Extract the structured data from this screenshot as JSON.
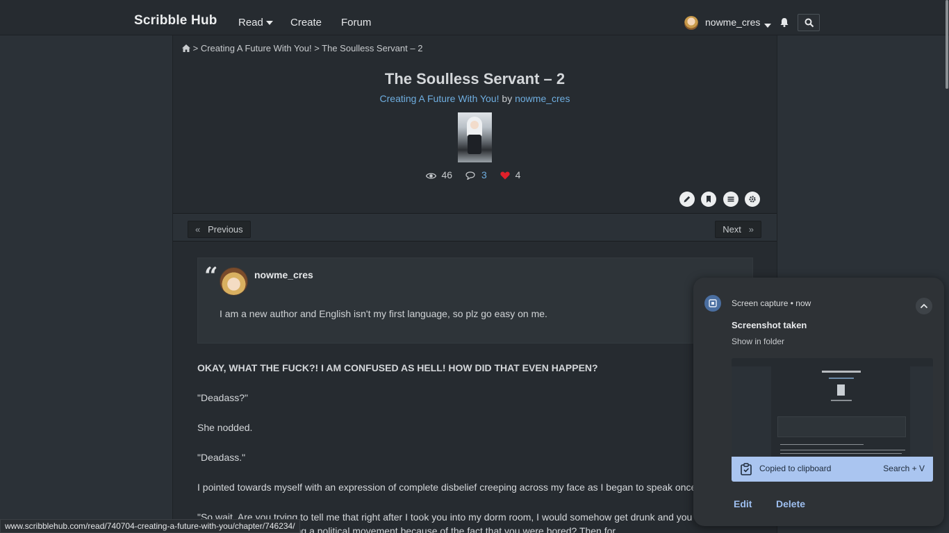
{
  "navbar": {
    "brand": "Scribble Hub",
    "read": "Read",
    "create": "Create",
    "forum": "Forum",
    "username": "nowme_cres"
  },
  "breadcrumb": {
    "separator1": ">",
    "series": "Creating A Future With You!",
    "separator2": ">",
    "chapter": "The Soulless Servant – 2"
  },
  "chapter": {
    "title": "The Soulless Servant – 2",
    "series_link": "Creating A Future With You!",
    "by": "by",
    "author": "nowme_cres",
    "views": "46",
    "comments": "3",
    "likes": "4"
  },
  "pager": {
    "prev_arrow": "«",
    "prev": "Previous",
    "next": "Next",
    "next_arrow": "»"
  },
  "author_note": {
    "quote": "“",
    "author": "nowme_cres",
    "text": "I am a new author and English isn't my first language, so plz go easy on me."
  },
  "body": {
    "p1": "OKAY, WHAT THE FUCK?! I AM CONFUSED AS HELL! HOW DID THAT EVEN HAPPEN?",
    "p2": "\"Deadass?\"",
    "p3": "She nodded.",
    "p4": "\"Deadass.\"",
    "p5": "I pointed towards myself with an expression of complete disbelief creeping across my face as I began to speak once again.",
    "p6": "\"So wait. Are you trying to tell me that right after I took you into my dorm room, I would somehow get drunk and you would...",
    "p7": "...ly idiotic idea of starting a political movement because of the fact that you were bored? Then for"
  },
  "status_url": "www.scribblehub.com/read/740704-creating-a-future-with-you/chapter/746234/",
  "notification": {
    "app": "Screen capture",
    "dot": "•",
    "time": "now",
    "title": "Screenshot taken",
    "subtitle": "Show in folder",
    "clipboard": "Copied to clipboard",
    "shortcut": "Search + V",
    "edit": "Edit",
    "delete": "Delete"
  },
  "colors": {
    "link": "#6faee0",
    "heart": "#e0202a",
    "clip_bar": "#aac5f0",
    "notif_action": "#9ebff0"
  }
}
